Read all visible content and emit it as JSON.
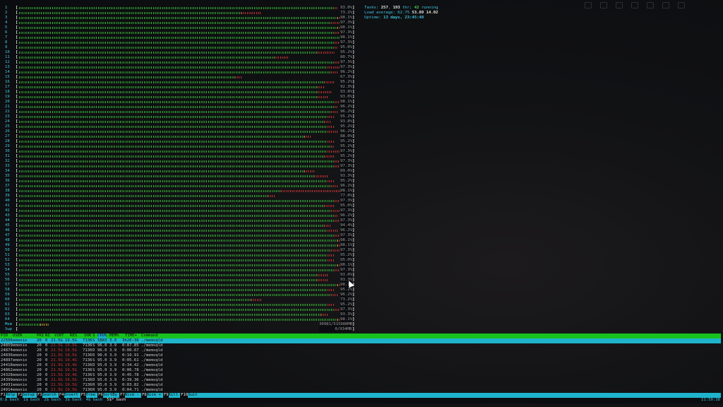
{
  "colors": {
    "accent_cyan": "#3fc4e0",
    "bar_green": "#37b437",
    "bar_red": "#c23535",
    "header_green": "#18c21e",
    "fn_cyan": "#1eb4cc"
  },
  "cpus": [
    {
      "label": "1",
      "load": 0.96,
      "red": 0.01,
      "pct": "93.0%"
    },
    {
      "label": "2",
      "load": 0.73,
      "red": 0.06,
      "pct": "73.2%"
    },
    {
      "label": "3",
      "load": 0.98,
      "red": 0.02,
      "pct": "98.1%"
    },
    {
      "label": "4",
      "load": 0.97,
      "red": 0.03,
      "pct": "97.3%"
    },
    {
      "label": "5",
      "load": 0.98,
      "red": 0.02,
      "pct": "98.1%"
    },
    {
      "label": "6",
      "load": 0.97,
      "red": 0.02,
      "pct": "97.3%"
    },
    {
      "label": "7",
      "load": 0.98,
      "red": 0.01,
      "pct": "98.1%"
    },
    {
      "label": "8",
      "load": 0.97,
      "red": 0.02,
      "pct": "97.3%"
    },
    {
      "label": "9",
      "load": 0.96,
      "red": 0.01,
      "pct": "95.0%"
    },
    {
      "label": "10",
      "load": 0.95,
      "red": 0.05,
      "pct": "95.2%"
    },
    {
      "label": "11",
      "load": 0.81,
      "red": 0.04,
      "pct": "80.7%"
    },
    {
      "label": "12",
      "load": 0.97,
      "red": 0.02,
      "pct": "97.3%"
    },
    {
      "label": "13",
      "load": 0.97,
      "red": 0.04,
      "pct": "97.3%"
    },
    {
      "label": "14",
      "load": 0.96,
      "red": 0.02,
      "pct": "96.2%"
    },
    {
      "label": "15",
      "load": 0.67,
      "red": 0.02,
      "pct": "67.3%"
    },
    {
      "label": "16",
      "load": 0.95,
      "red": 0.03,
      "pct": "95.2%"
    },
    {
      "label": "17",
      "load": 0.92,
      "red": 0.02,
      "pct": "92.3%"
    },
    {
      "label": "18",
      "load": 0.94,
      "red": 0.04,
      "pct": "93.8%"
    },
    {
      "label": "19",
      "load": 0.93,
      "red": 0.03,
      "pct": "93.0%"
    },
    {
      "label": "20",
      "load": 0.98,
      "red": 0.03,
      "pct": "98.1%"
    },
    {
      "label": "21",
      "load": 0.96,
      "red": 0.01,
      "pct": "96.2%"
    },
    {
      "label": "22",
      "load": 0.96,
      "red": 0.02,
      "pct": "96.2%"
    },
    {
      "label": "23",
      "load": 0.95,
      "red": 0.02,
      "pct": "95.2%"
    },
    {
      "label": "24",
      "load": 0.94,
      "red": 0.02,
      "pct": "93.8%"
    },
    {
      "label": "25",
      "load": 0.95,
      "red": 0.02,
      "pct": "95.2%"
    },
    {
      "label": "26",
      "load": 0.96,
      "red": 0.03,
      "pct": "96.2%"
    },
    {
      "label": "27",
      "load": 0.88,
      "red": 0.02,
      "pct": "88.0%"
    },
    {
      "label": "28",
      "load": 0.95,
      "red": 0.02,
      "pct": "95.2%"
    },
    {
      "label": "29",
      "load": 0.95,
      "red": 0.01,
      "pct": "95.2%"
    },
    {
      "label": "30",
      "load": 0.97,
      "red": 0.04,
      "pct": "97.3%"
    },
    {
      "label": "31",
      "load": 0.95,
      "red": 0.03,
      "pct": "95.2%"
    },
    {
      "label": "32",
      "load": 0.97,
      "red": 0.02,
      "pct": "97.3%"
    },
    {
      "label": "33",
      "load": 0.97,
      "red": 0.02,
      "pct": "97.3%"
    },
    {
      "label": "34",
      "load": 0.89,
      "red": 0.03,
      "pct": "89.0%"
    },
    {
      "label": "35",
      "load": 0.93,
      "red": 0.04,
      "pct": "93.3%"
    },
    {
      "label": "36",
      "load": 0.95,
      "red": 0.02,
      "pct": "95.2%"
    },
    {
      "label": "37",
      "load": 0.96,
      "red": 0.02,
      "pct": "96.2%"
    },
    {
      "label": "38",
      "load": 0.97,
      "red": 0.18,
      "pct": "98.1%"
    },
    {
      "label": "39",
      "load": 0.77,
      "red": 0.02,
      "pct": "77.0%"
    },
    {
      "label": "40",
      "load": 0.97,
      "red": 0.02,
      "pct": "97.3%"
    },
    {
      "label": "41",
      "load": 0.95,
      "red": 0.03,
      "pct": "95.0%"
    },
    {
      "label": "42",
      "load": 0.97,
      "red": 0.03,
      "pct": "97.3%"
    },
    {
      "label": "43",
      "load": 0.96,
      "red": 0.01,
      "pct": "96.2%"
    },
    {
      "label": "44",
      "load": 0.97,
      "red": 0.02,
      "pct": "97.3%"
    },
    {
      "label": "45",
      "load": 0.94,
      "red": 0.02,
      "pct": "94.4%"
    },
    {
      "label": "46",
      "load": 0.96,
      "red": 0.03,
      "pct": "96.2%"
    },
    {
      "label": "47",
      "load": 0.97,
      "red": 0.02,
      "pct": "97.3%"
    },
    {
      "label": "48",
      "load": 0.98,
      "red": 0.02,
      "pct": "98.1%"
    },
    {
      "label": "49",
      "load": 0.98,
      "red": 0.02,
      "pct": "98.1%"
    },
    {
      "label": "50",
      "load": 0.97,
      "red": 0.03,
      "pct": "97.3%"
    },
    {
      "label": "51",
      "load": 0.95,
      "red": 0.02,
      "pct": "95.2%"
    },
    {
      "label": "52",
      "load": 0.95,
      "red": 0.02,
      "pct": "95.0%"
    },
    {
      "label": "53",
      "load": 0.98,
      "red": 0.02,
      "pct": "98.1%"
    },
    {
      "label": "54",
      "load": 0.97,
      "red": 0.02,
      "pct": "97.3%"
    },
    {
      "label": "55",
      "load": 0.93,
      "red": 0.03,
      "pct": "93.0%"
    },
    {
      "label": "56",
      "load": 0.93,
      "red": 0.03,
      "pct": "93.3%"
    },
    {
      "label": "57",
      "load": 0.98,
      "red": 0.02,
      "pct": "98.1%"
    },
    {
      "label": "58",
      "load": 0.95,
      "red": 0.02,
      "pct": "95.2%"
    },
    {
      "label": "59",
      "load": 0.96,
      "red": 0.02,
      "pct": "96.2%"
    },
    {
      "label": "60",
      "load": 0.73,
      "red": 0.03,
      "pct": "73.2%"
    },
    {
      "label": "61",
      "load": 0.95,
      "red": 0.02,
      "pct": "95.2%"
    },
    {
      "label": "62",
      "load": 0.97,
      "red": 0.02,
      "pct": "97.3%"
    },
    {
      "label": "63",
      "load": 0.93,
      "red": 0.02,
      "pct": "93.3%"
    },
    {
      "label": "64",
      "load": 0.98,
      "red": 0.02,
      "pct": "98.1%"
    }
  ],
  "mem": {
    "label": "Mem",
    "used_fraction": 0.09,
    "text": "30981/515980MB"
  },
  "swp": {
    "label": "Swp",
    "used_fraction": 0.0,
    "text": "0/934MB"
  },
  "tasks": {
    "label": "Tasks:",
    "tasks": "257",
    "sep1": ",",
    "thr": "193",
    "thr_label": "thr;",
    "running": "42",
    "running_label": "running"
  },
  "load": {
    "label": "Load average:",
    "avg1": "62.75",
    "avg5": "53.89",
    "avg15": "14.02"
  },
  "uptime": {
    "label": "Uptime:",
    "value": "13 days, 23:45:48"
  },
  "proc_columns": [
    {
      "key": "pid",
      "label": "PID"
    },
    {
      "key": "user",
      "label": "USER"
    },
    {
      "key": "pri",
      "label": "PRI"
    },
    {
      "key": "ni",
      "label": "NI"
    },
    {
      "key": "virt",
      "label": "VIRT"
    },
    {
      "key": "res",
      "label": "RES"
    },
    {
      "key": "shr",
      "label": "SHR"
    },
    {
      "key": "s",
      "label": "S"
    },
    {
      "key": "cpu",
      "label": "CPU%"
    },
    {
      "key": "mem",
      "label": "MEM%"
    },
    {
      "key": "time",
      "label": "TIME+"
    },
    {
      "key": "cmd",
      "label": "Command"
    }
  ],
  "processes": [
    {
      "pid": "22506",
      "user": "emonio",
      "pri": "20",
      "ni": "0",
      "virt": "21.5G",
      "res": "19.5G",
      "shr": "7136",
      "s": "S",
      "cpu": "5883",
      "mem": "3.9",
      "time": "3h20:38",
      "cmd": "./memsqld"
    },
    {
      "pid": "24859",
      "user": "emonio",
      "pri": "20",
      "ni": "0",
      "virt": "21.5G",
      "res": "19.5G",
      "shr": "7136",
      "s": "S",
      "cpu": "96.0",
      "mem": "3.9",
      "time": "0:87.85",
      "cmd": "./memsqld"
    },
    {
      "pid": "24874",
      "user": "emonio",
      "pri": "20",
      "ni": "0",
      "virt": "21.5G",
      "res": "19.5G",
      "shr": "7136",
      "s": "D",
      "cpu": "96.0",
      "mem": "3.9",
      "time": "0:00.67",
      "cmd": "./memsqld"
    },
    {
      "pid": "24836",
      "user": "emonio",
      "pri": "20",
      "ni": "0",
      "virt": "21.5G",
      "res": "19.5G",
      "shr": "7136",
      "s": "D",
      "cpu": "96.0",
      "mem": "3.9",
      "time": "0:10.91",
      "cmd": "./memsqld"
    },
    {
      "pid": "24897",
      "user": "emonio",
      "pri": "20",
      "ni": "0",
      "virt": "21.5G",
      "res": "19.4G",
      "shr": "7136",
      "s": "S",
      "cpu": "95.0",
      "mem": "3.9",
      "time": "0:05.61",
      "cmd": "./memsqld"
    },
    {
      "pid": "24418",
      "user": "emonio",
      "pri": "20",
      "ni": "0",
      "virt": "21.5G",
      "res": "19.4G",
      "shr": "7136",
      "s": "D",
      "cpu": "95.0",
      "mem": "3.9",
      "time": "0:34.42",
      "cmd": "./memsqld"
    },
    {
      "pid": "24862",
      "user": "emonio",
      "pri": "20",
      "ni": "0",
      "virt": "21.5G",
      "res": "19.5G",
      "shr": "7136",
      "s": "S",
      "cpu": "95.0",
      "mem": "3.9",
      "time": "0:06.78",
      "cmd": "./memsqld"
    },
    {
      "pid": "24328",
      "user": "emonio",
      "pri": "20",
      "ni": "0",
      "virt": "21.5G",
      "res": "19.4G",
      "shr": "7136",
      "s": "S",
      "cpu": "95.0",
      "mem": "3.9",
      "time": "0:45.78",
      "cmd": "./memsqld"
    },
    {
      "pid": "24399",
      "user": "emonio",
      "pri": "20",
      "ni": "0",
      "virt": "21.5G",
      "res": "19.5G",
      "shr": "7136",
      "s": "D",
      "cpu": "95.0",
      "mem": "3.9",
      "time": "0:39.36",
      "cmd": "./memsqld"
    },
    {
      "pid": "24931",
      "user": "emonio",
      "pri": "20",
      "ni": "0",
      "virt": "21.5G",
      "res": "19.5G",
      "shr": "7136",
      "s": "R",
      "cpu": "95.0",
      "mem": "3.9",
      "time": "0:03.82",
      "cmd": "./memsqld"
    },
    {
      "pid": "24914",
      "user": "emonio",
      "pri": "20",
      "ni": "0",
      "virt": "21.5G",
      "res": "19.5G",
      "shr": "7136",
      "s": "R",
      "cpu": "95.0",
      "mem": "3.9",
      "time": "0:04.71",
      "cmd": "./memsqld"
    }
  ],
  "fn_keys": [
    {
      "key": "F1",
      "label": "Help"
    },
    {
      "key": "F2",
      "label": "Setup"
    },
    {
      "key": "F3",
      "label": "Search"
    },
    {
      "key": "F4",
      "label": "Invert"
    },
    {
      "key": "F5",
      "label": "Tree"
    },
    {
      "key": "F6",
      "label": "SortBy"
    },
    {
      "key": "F7",
      "label": "Nice -"
    },
    {
      "key": "F8",
      "label": "Nice +"
    },
    {
      "key": "F9",
      "label": "Kill"
    },
    {
      "key": "F10",
      "label": "Quit"
    }
  ],
  "tmux": {
    "windows": [
      "0:$ bash",
      "1$ bash",
      "2$ bash",
      "3$ bash",
      "4$ bash",
      "5$* bash"
    ],
    "active_index": 5,
    "clock": "11:50:38"
  },
  "desktop_icons": [
    "window-icon",
    "apps-icon",
    "mail-icon",
    "settings-icon",
    "network-icon",
    "volume-icon",
    "power-icon"
  ]
}
